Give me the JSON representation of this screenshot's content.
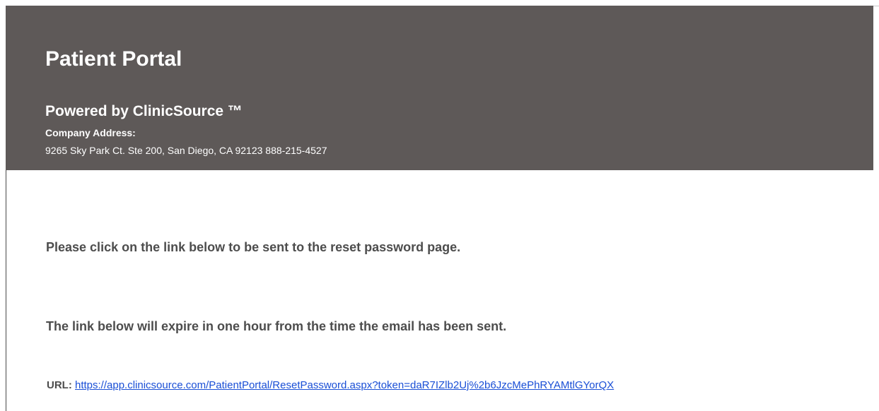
{
  "header": {
    "title": "Patient Portal",
    "powered_by": "Powered by ClinicSource ™",
    "address_label": "Company Address:",
    "address": "9265 Sky Park Ct. Ste 200, San Diego, CA 92123 888-215-4527"
  },
  "body": {
    "reset_message": "Please click on the link below to be sent to the reset password page.",
    "expire_message": "The link below will expire in one hour from the time the email has been sent.",
    "url_label": "URL:",
    "url": "https://app.clinicsource.com/PatientPortal/ResetPassword.aspx?token=daR7IZlb2Uj%2b6JzcMePhRYAMtlGYorQX"
  },
  "colors": {
    "header_background": "#5e5958",
    "header_text": "#ffffff",
    "body_text": "#4d4d4d",
    "link": "#1a4fd6"
  }
}
